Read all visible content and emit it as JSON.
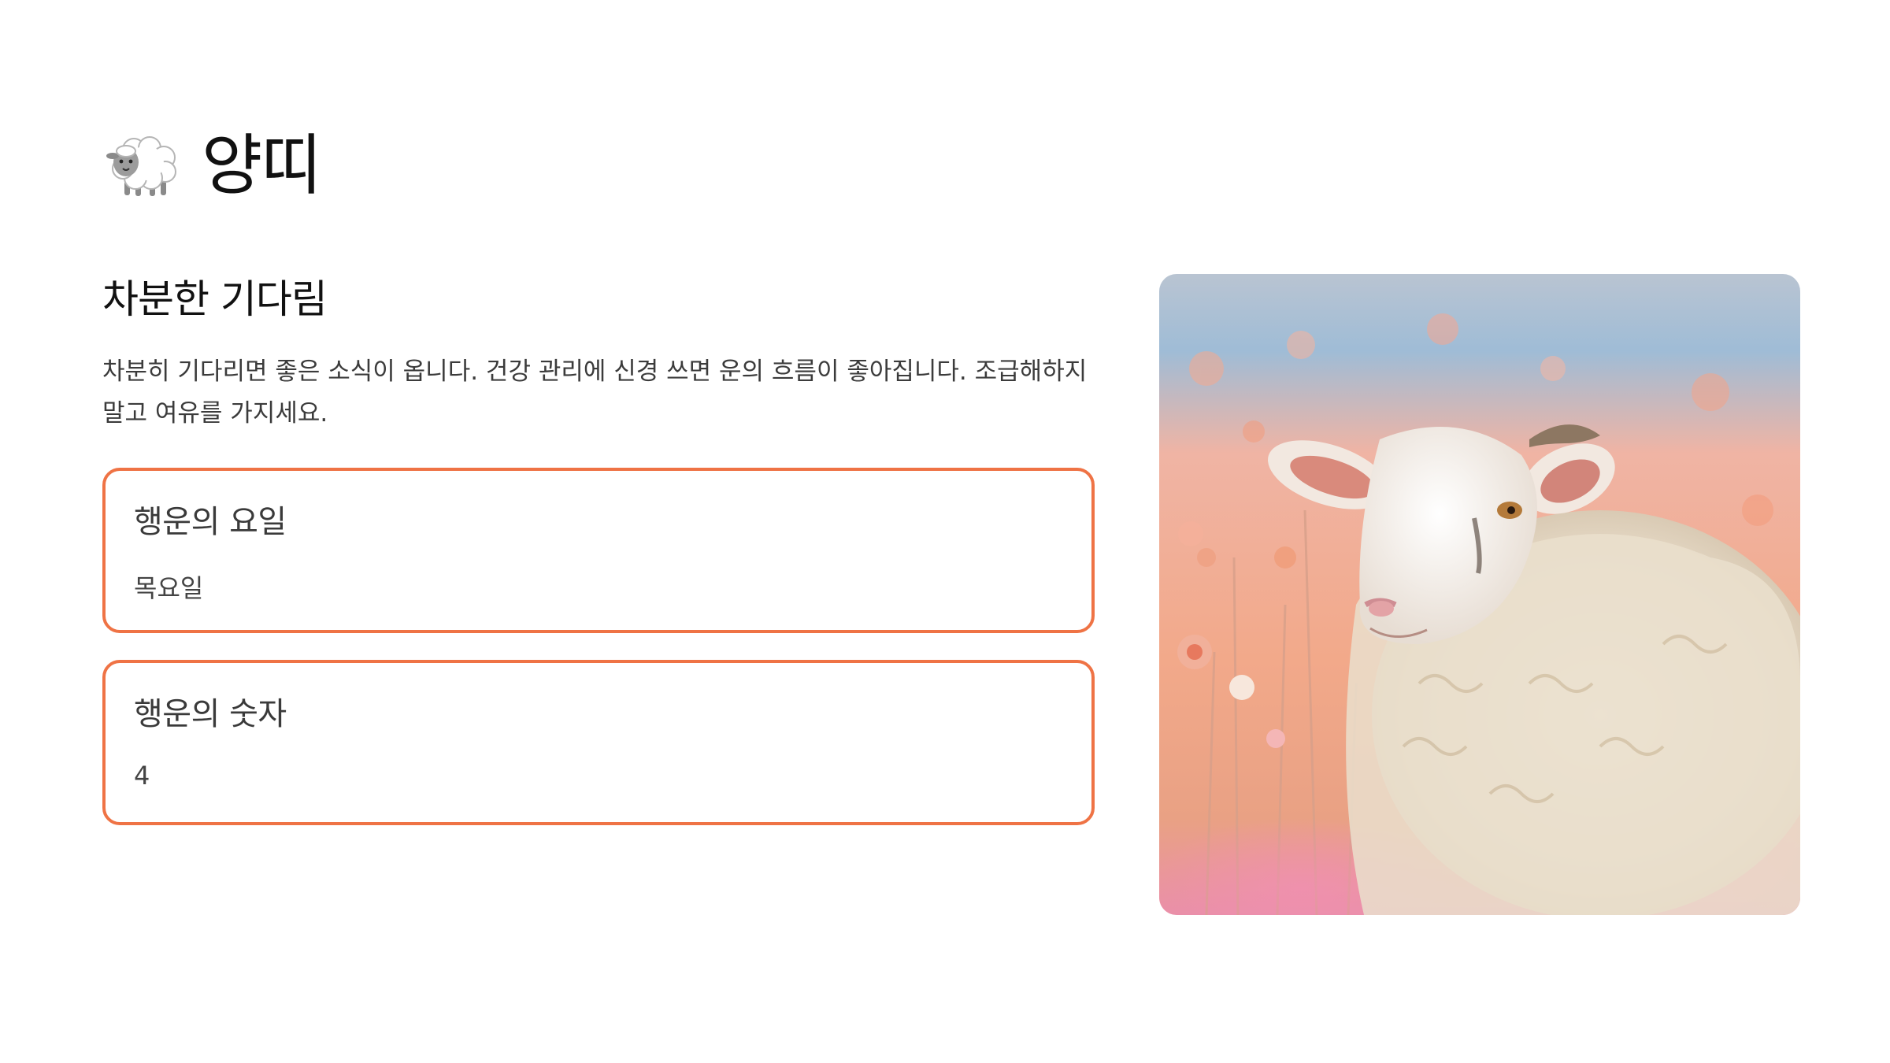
{
  "header": {
    "icon": "sheep-emoji-icon",
    "title": "양띠"
  },
  "main": {
    "section_title": "차분한 기다림",
    "description": "차분히 기다리면 좋은 소식이 옵니다. 건강 관리에 신경 쓰면 운의 흐름이 좋아집니다. 조급해하지 말고 여유를 가지세요.",
    "cards": [
      {
        "label": "행운의 요일",
        "value": "목요일"
      },
      {
        "label": "행운의 숫자",
        "value": "4"
      }
    ]
  },
  "image": {
    "subject": "sheep-in-flower-field",
    "colors": {
      "sky": "#8fb6d6",
      "field": "#f2a98c",
      "pink": "#ee8fb0",
      "accent_border": "#ef7345"
    }
  }
}
